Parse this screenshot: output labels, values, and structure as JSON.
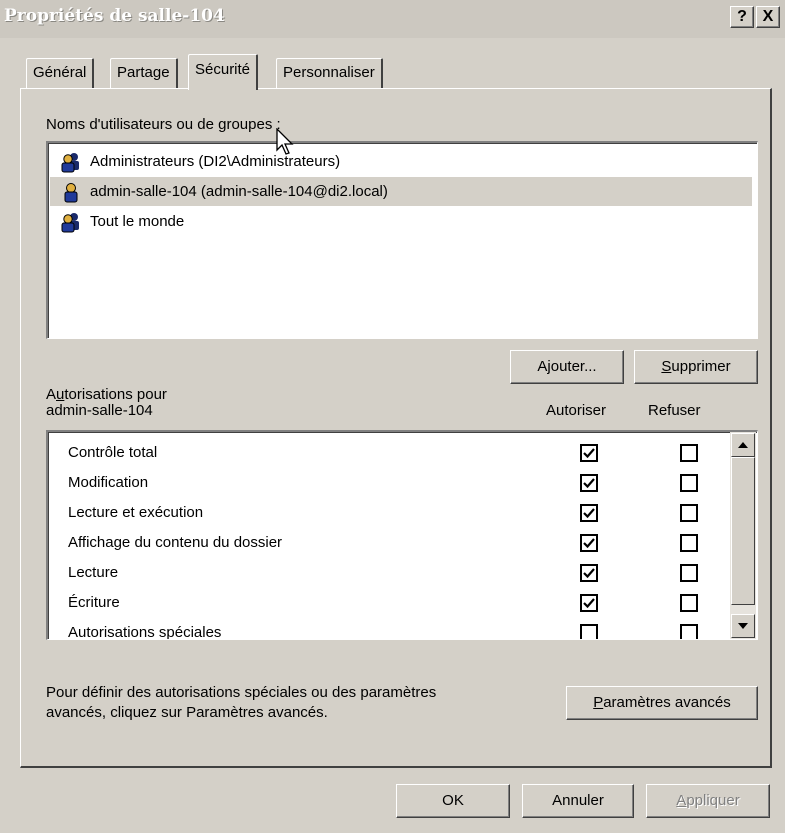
{
  "window": {
    "title": "Propriétés de salle-104",
    "help_label": "?",
    "close_label": "X"
  },
  "tabs": [
    {
      "label": "Général",
      "active": false
    },
    {
      "label": "Partage",
      "active": false
    },
    {
      "label": "Sécurité",
      "active": true
    },
    {
      "label": "Personnaliser",
      "active": false
    }
  ],
  "users_section": {
    "label_pre": "Noms d'utilisateurs ou de ",
    "label_accel": "g",
    "label_post": "roupes :",
    "items": [
      {
        "name": "Administrateurs (DI2\\Administrateurs)",
        "icon": "group-icon"
      },
      {
        "name": "admin-salle-104 (admin-salle-104@di2.local)",
        "icon": "user-icon"
      },
      {
        "name": "Tout le monde",
        "icon": "group-icon"
      }
    ],
    "selected_index": 1
  },
  "buttons": {
    "add_pre": "A",
    "add_accel": "j",
    "add_post": "outer...",
    "remove_accel": "S",
    "remove_post": "upprimer",
    "advanced_accel": "P",
    "advanced_post": "aramètres avancés",
    "ok": "OK",
    "cancel": "Annuler",
    "apply_accel": "A",
    "apply_post": "ppliquer"
  },
  "permissions": {
    "label_line1_pre": "A",
    "label_line1_accel": "u",
    "label_line1_post": "torisations pour",
    "label_line2": "admin-salle-104",
    "allow_header": "Autoriser",
    "deny_header": "Refuser",
    "rows": [
      {
        "name": "Contrôle total",
        "allow": true,
        "deny": false
      },
      {
        "name": "Modification",
        "allow": true,
        "deny": false
      },
      {
        "name": "Lecture et exécution",
        "allow": true,
        "deny": false
      },
      {
        "name": "Affichage du contenu du dossier",
        "allow": true,
        "deny": false
      },
      {
        "name": "Lecture",
        "allow": true,
        "deny": false
      },
      {
        "name": "Écriture",
        "allow": true,
        "deny": false
      },
      {
        "name": "Autorisations spéciales",
        "allow": false,
        "deny": false
      }
    ]
  },
  "advanced_info": {
    "line1": "Pour définir des autorisations spéciales ou des paramètres",
    "line2": "avancés, cliquez sur Paramètres avancés."
  },
  "colors": {
    "face": "#d4d0c8",
    "window": "#ffffff",
    "disabled_text": "#808080"
  }
}
